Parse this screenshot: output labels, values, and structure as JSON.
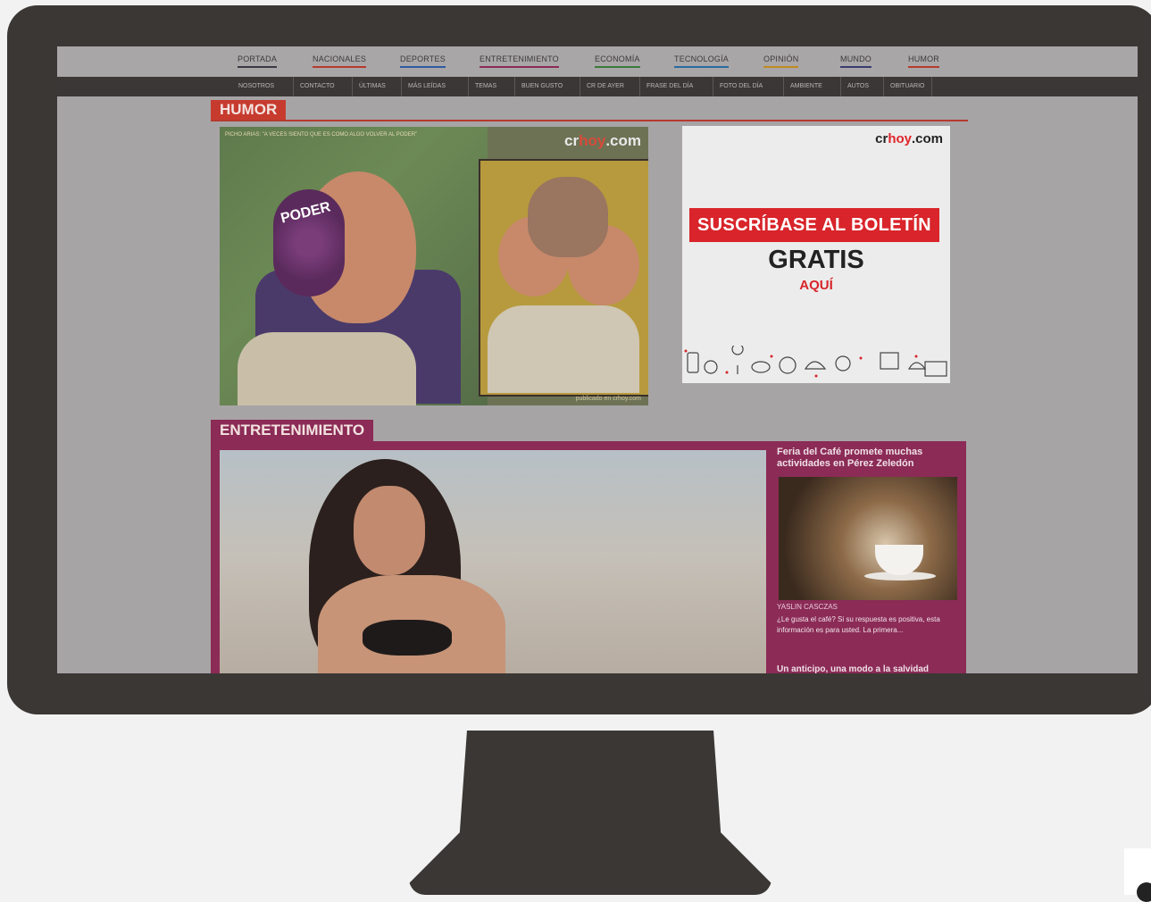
{
  "topnav": {
    "items": [
      {
        "label": "PORTADA",
        "color": "#3a3a44"
      },
      {
        "label": "NACIONALES",
        "color": "#b53a2c"
      },
      {
        "label": "DEPORTES",
        "color": "#2d5aa0"
      },
      {
        "label": "ENTRETENIMIENTO",
        "color": "#8b2b56"
      },
      {
        "label": "ECONOMÍA",
        "color": "#3a7a3a"
      },
      {
        "label": "TECNOLOGÍA",
        "color": "#2a6aa0"
      },
      {
        "label": "OPINIÓN",
        "color": "#c08a20"
      },
      {
        "label": "MUNDO",
        "color": "#3a3a70"
      },
      {
        "label": "HUMOR",
        "color": "#b53a2c"
      }
    ]
  },
  "subnav": {
    "items": [
      "NOSOTROS",
      "CONTACTO",
      "ÚLTIMAS",
      "MÁS LEÍDAS",
      "TEMAS",
      "BUEN GUSTO",
      "CR DE AYER",
      "FRASE DEL DÍA",
      "FOTO DEL DÍA",
      "AMBIENTE",
      "AUTOS",
      "OBITUARIO"
    ]
  },
  "humor": {
    "section_label": "HUMOR",
    "cartoon_caption": "PICHO ARIAS: \"A VECES SIENTO QUE ES COMO ALGO VOLVER AL PODER\"",
    "cartoon_word": "PODER",
    "logo_prefix": "cr",
    "logo_mid": "hoy",
    "logo_suffix": ".com",
    "credit": "publicado en crhoy.com"
  },
  "ad": {
    "logo_prefix": "cr",
    "logo_mid": "hoy",
    "logo_suffix": ".com",
    "banner": "SUSCRÍBASE AL BOLETÍN",
    "gratis": "GRATIS",
    "aqui": "AQUÍ",
    "accent": "#d8242a"
  },
  "entretenimiento": {
    "section_label": "ENTRETENIMIENTO",
    "side_title": "Feria del Café promete muchas actividades en Pérez Zeledón",
    "side_author": "YASLIN CASCZAS",
    "side_text": "¿Le gusta el café? Si su respuesta es positiva, esta información es para usted. La primera...",
    "side_next": "Un anticipo, una modo a la salvidad",
    "accent": "#8b2b56"
  }
}
